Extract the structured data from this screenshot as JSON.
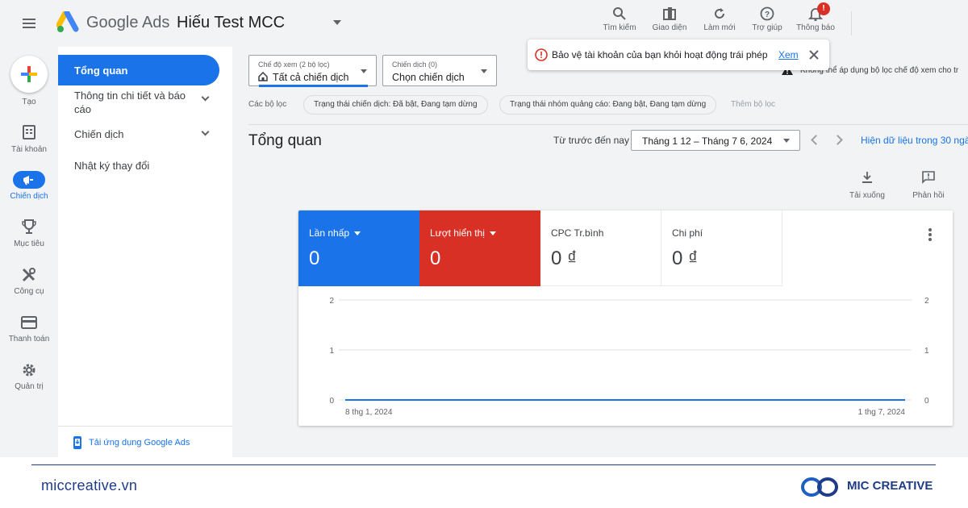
{
  "header": {
    "brand_google": "Google",
    "brand_ads": "Ads",
    "account_name": "Hiếu Test MCC",
    "tools": [
      {
        "label": "Tìm kiếm",
        "icon": "search-icon"
      },
      {
        "label": "Giao diện",
        "icon": "appearance-icon"
      },
      {
        "label": "Làm mới",
        "icon": "refresh-icon"
      },
      {
        "label": "Trợ giúp",
        "icon": "help-icon"
      },
      {
        "label": "Thông báo",
        "icon": "bell-icon"
      }
    ],
    "notification_badge": "!"
  },
  "rail": {
    "create_label": "Tạo",
    "items": [
      {
        "label": "Tài khoản",
        "icon": "account-icon"
      },
      {
        "label": "Chiến dịch",
        "icon": "campaign-icon"
      },
      {
        "label": "Mục tiêu",
        "icon": "trophy-icon"
      },
      {
        "label": "Công cụ",
        "icon": "tools-icon"
      },
      {
        "label": "Thanh toán",
        "icon": "billing-icon"
      },
      {
        "label": "Quản trị",
        "icon": "admin-gear-icon"
      }
    ]
  },
  "sidenav": {
    "items": [
      {
        "label": "Tổng quan"
      },
      {
        "label": "Thông tin chi tiết và báo",
        "label_line2": "cáo"
      },
      {
        "label": "Chiến dịch"
      },
      {
        "label": "Nhật ký thay đổi"
      }
    ],
    "app_download": "Tải ứng dụng Google Ads"
  },
  "toolbar": {
    "view_mode_small": "Chế độ xem (2 bộ lọc)",
    "view_mode_value": "Tất cả chiến dịch",
    "campaign_small": "Chiến dịch (0)",
    "campaign_value": "Chọn chiến dịch",
    "filters_label": "Các bộ lọc",
    "chips": [
      "Trạng thái chiến dịch: Đã bật, Đang tạm dừng",
      "Trạng thái nhóm quảng cáo: Đang bật, Đang tạm dừng"
    ],
    "add_filter": "Thêm bộ lọc",
    "warning": "Không thể áp dụng bộ lọc chế độ xem cho tr"
  },
  "popup": {
    "message": "Bảo vệ tài khoản của bạn khỏi hoạt động trái phép",
    "link": "Xem"
  },
  "overview": {
    "title": "Tổng quan",
    "range_label": "Từ trước đến nay",
    "date_range": "Tháng 1 12 – Tháng 7 6, 2024",
    "data_link": "Hiện dữ liệu trong 30 ngà",
    "download": "Tải xuống",
    "feedback": "Phản hồi"
  },
  "metrics": [
    {
      "name": "Lần nhấp",
      "value": "0",
      "color": "#1a73e8"
    },
    {
      "name": "Lượt hiển thị",
      "value": "0",
      "color": "#d93025"
    },
    {
      "name": "CPC Tr.bình",
      "value": "0 ₫"
    },
    {
      "name": "Chi phí",
      "value": "0 ₫"
    }
  ],
  "chart_data": {
    "type": "line",
    "x": [
      "8 thg 1, 2024",
      "1 thg 7, 2024"
    ],
    "y_ticks": [
      0,
      1,
      2
    ],
    "ylim": [
      0,
      2
    ],
    "series": [
      {
        "values": [
          0,
          0
        ],
        "color": "#d93025"
      },
      {
        "values": [
          0,
          0
        ],
        "color": "#1a73e8"
      }
    ],
    "grid": true
  },
  "footer": {
    "site": "miccreative.vn",
    "brand": "MIC CREATIVE"
  }
}
